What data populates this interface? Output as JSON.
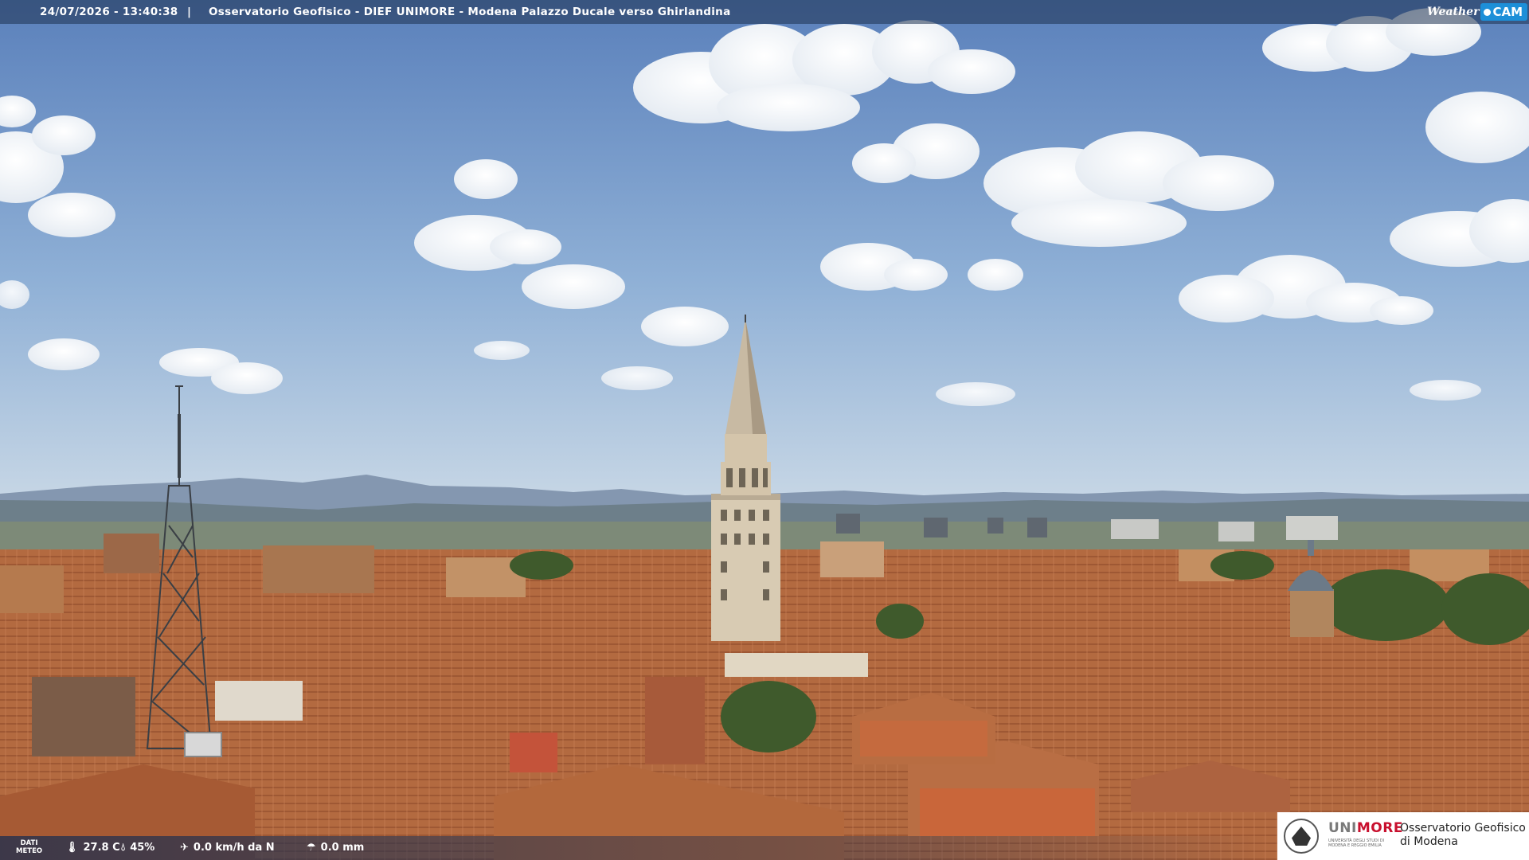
{
  "overlay": {
    "timestamp": "24/07/2026 - 13:40:38",
    "separator": "|",
    "title": "Osservatorio Geofisico - DIEF UNIMORE - Modena Palazzo Ducale verso Ghirlandina"
  },
  "brand": {
    "weather": "Weather",
    "cam": "CAM",
    "accent": "#1d8fd8"
  },
  "meteo": {
    "label_line1": "DATI",
    "label_line2": "METEO",
    "temperature": "27.8 C",
    "humidity": "45%",
    "wind": "0.0 km/h da N",
    "rain": "0.0 mm"
  },
  "logo": {
    "uni_part1": "UNI",
    "uni_part2": "MORE",
    "uni_sub": "UNIVERSITÀ DEGLI STUDI DI MODENA E REGGIO EMILIA",
    "osserv_line1": "Osservatorio Geofisico",
    "osserv_line2": "di Modena"
  },
  "icons": [
    "thermometer-icon",
    "humidity-icon",
    "wind-icon",
    "rain-icon"
  ],
  "colors": {
    "sky_top": "#5f86c0",
    "sky_horizon": "#b9cde0",
    "roofs": "#b4673e"
  }
}
